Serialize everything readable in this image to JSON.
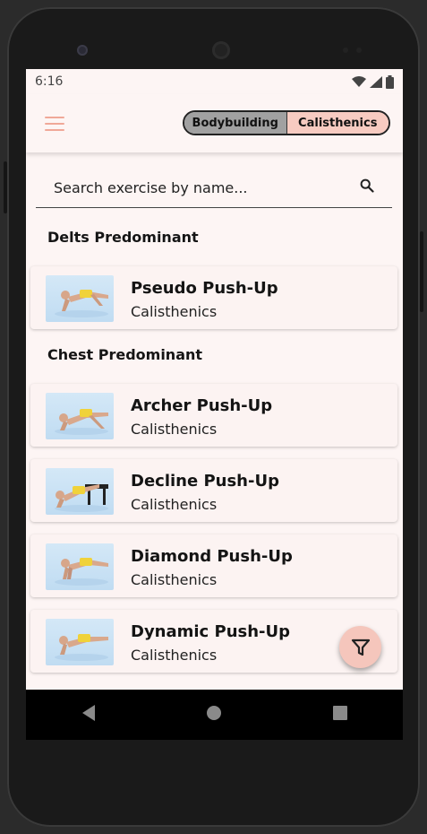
{
  "status": {
    "time": "6:16"
  },
  "header": {
    "toggle_left": "Bodybuilding",
    "toggle_right": "Calisthenics",
    "menu_icon": "hamburger-menu-icon"
  },
  "search": {
    "placeholder": "Search exercise by name...",
    "icon": "search-icon"
  },
  "sections": [
    {
      "title": "Delts Predominant",
      "items": [
        {
          "name": "Pseudo Push-Up",
          "category": "Calisthenics"
        }
      ]
    },
    {
      "title": "Chest Predominant",
      "items": [
        {
          "name": "Archer Push-Up",
          "category": "Calisthenics"
        },
        {
          "name": "Decline Push-Up",
          "category": "Calisthenics"
        },
        {
          "name": "Diamond Push-Up",
          "category": "Calisthenics"
        },
        {
          "name": "Dynamic Push-Up",
          "category": "Calisthenics"
        }
      ]
    }
  ],
  "fab": {
    "icon": "filter-icon"
  },
  "colors": {
    "accent": "#f5c6bc",
    "background": "#fdf5f4",
    "toggle_inactive": "#a1a1a1"
  }
}
